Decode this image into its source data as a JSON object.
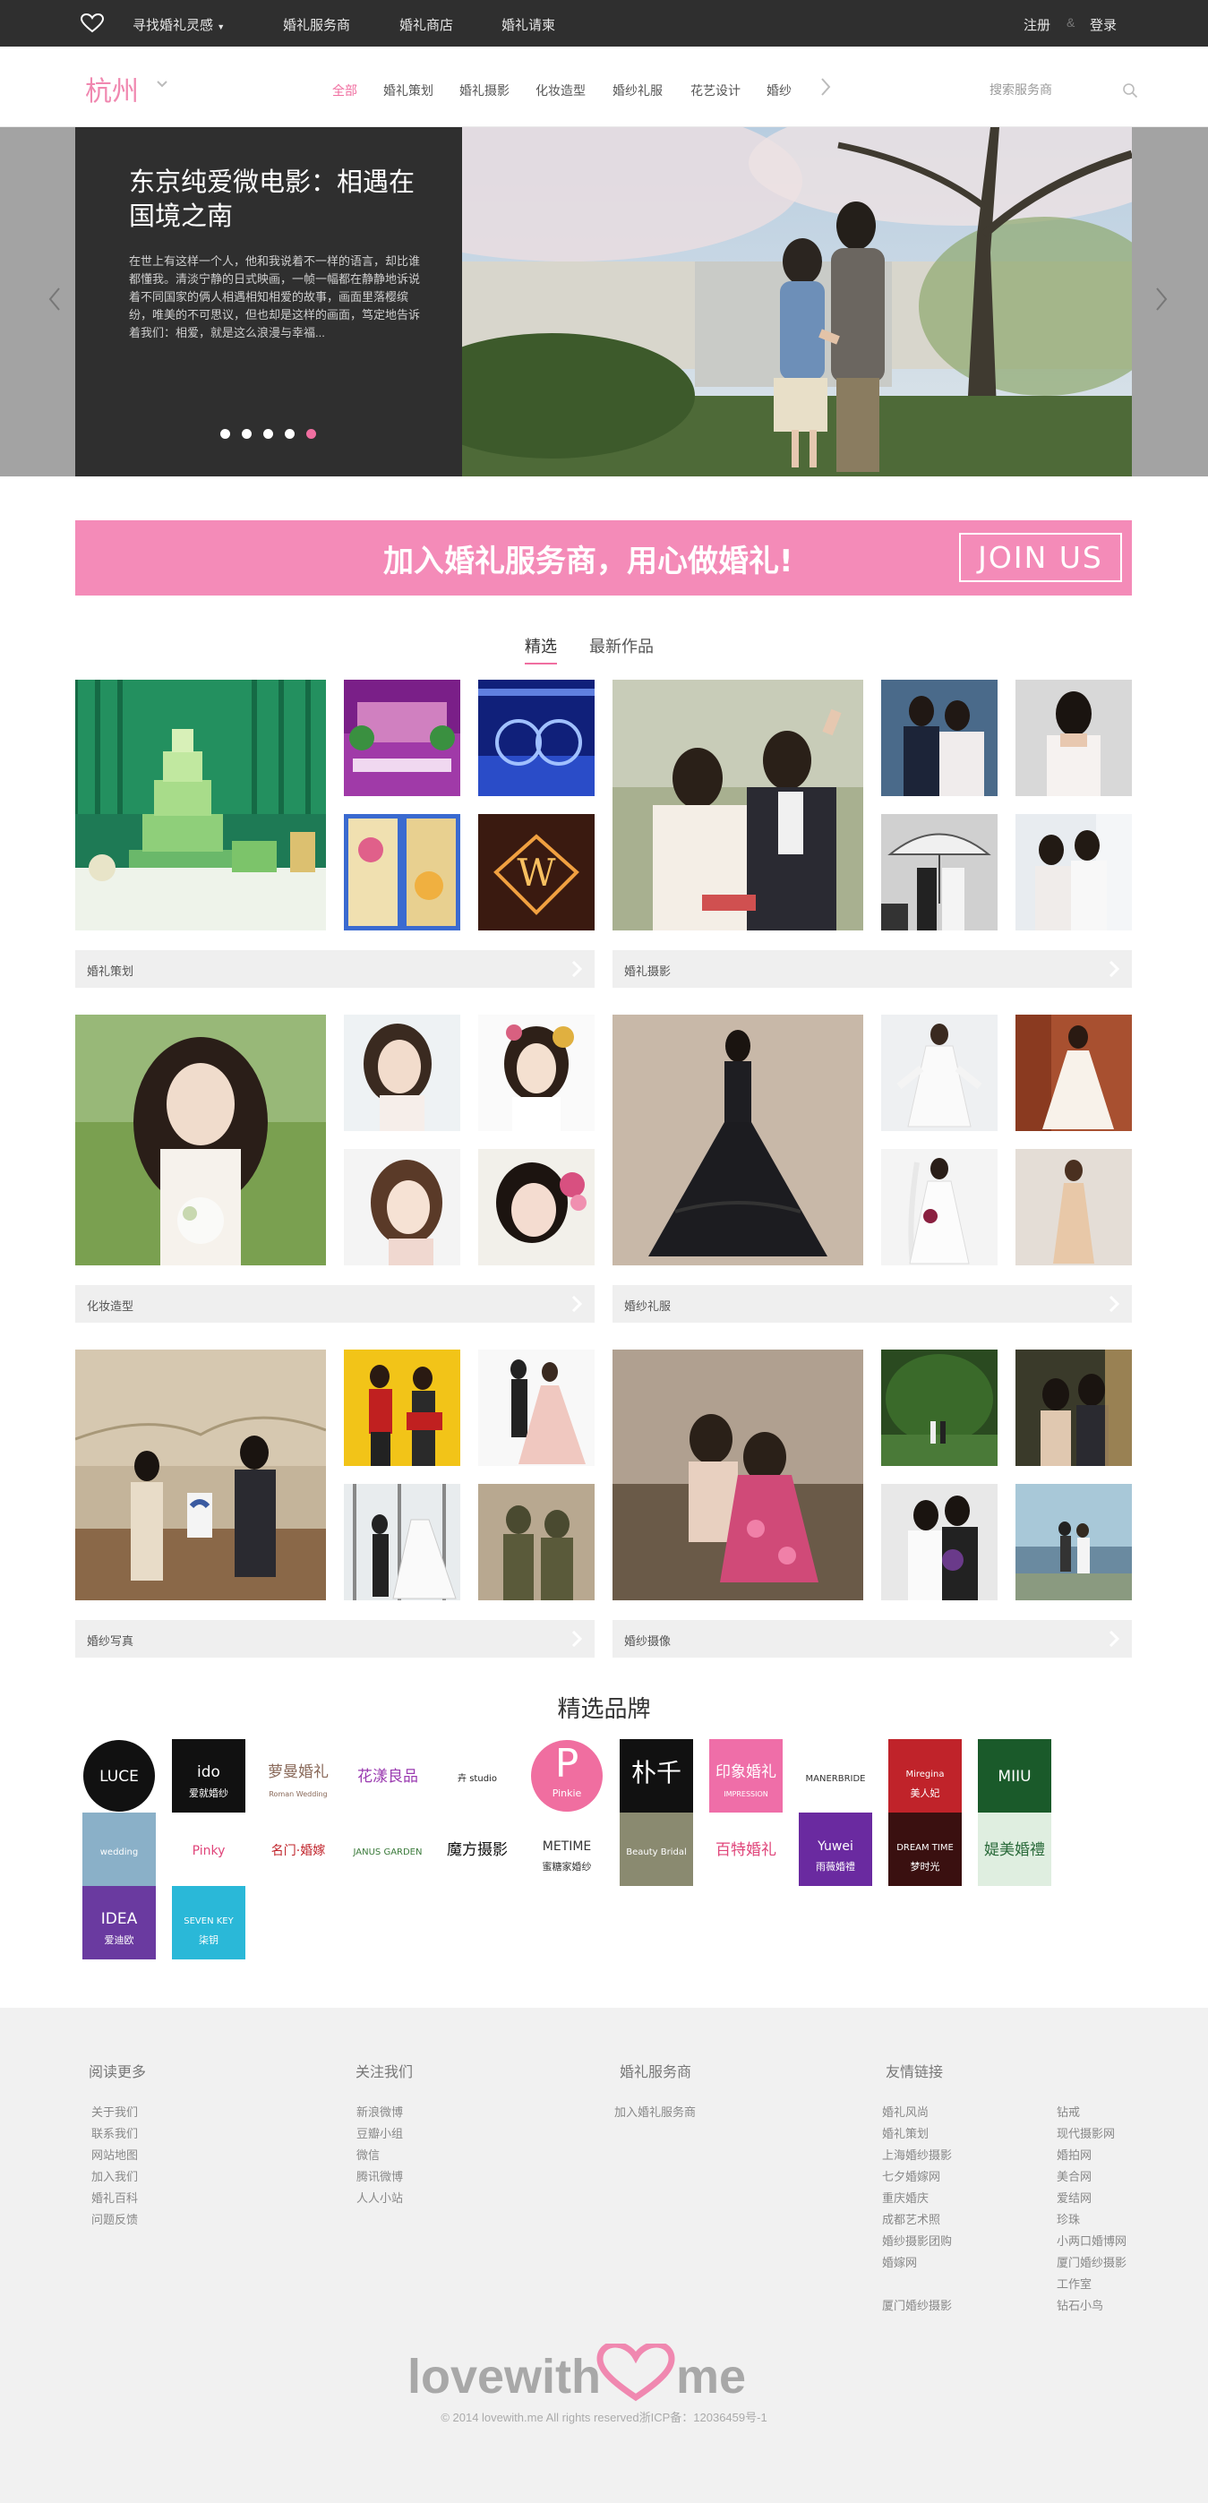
{
  "topbar": {
    "inspiration": "寻找婚礼灵感",
    "services": "婚礼服务商",
    "shop": "婚礼商店",
    "invite": "婚礼请柬",
    "register": "注册",
    "separator": "&",
    "login": "登录"
  },
  "header": {
    "city": "杭州",
    "categories": [
      "全部",
      "婚礼策划",
      "婚礼摄影",
      "化妆造型",
      "婚纱礼服",
      "花艺设计",
      "婚纱"
    ],
    "search_placeholder": "搜索服务商"
  },
  "hero": {
    "title": "东京纯爱微电影：相遇在国境之南",
    "description": "在世上有这样一个人，他和我说着不一样的语言，却比谁都懂我。清淡宁静的日式映画，一帧一幅都在静静地诉说着不同国家的俩人相遇相知相爱的故事，画面里落樱缤纷，唯美的不可思议，但也却是这样的画面，笃定地告诉着我们：相爱，就是这么浪漫与幸福...",
    "slide_count": 5,
    "active_slide": 5
  },
  "join": {
    "text": "加入婚礼服务商，用心做婚礼!",
    "button": "JOIN US"
  },
  "tabs": {
    "featured": "精选",
    "latest": "最新作品"
  },
  "cards": [
    {
      "label": "婚礼策划"
    },
    {
      "label": "婚礼摄影"
    },
    {
      "label": "化妆造型"
    },
    {
      "label": "婚纱礼服"
    },
    {
      "label": "婚纱写真"
    },
    {
      "label": "婚纱摄像"
    }
  ],
  "brands_title": "精选品牌",
  "brands": [
    {
      "name": "LUCE",
      "bg": "#111111",
      "fg": "#ffffff",
      "shape": "circle"
    },
    {
      "name": "ido",
      "sub": "爱就婚纱",
      "bg": "#111111",
      "fg": "#ffffff"
    },
    {
      "name": "萝曼婚礼",
      "sub": "Roman Wedding",
      "bg": "#ffffff",
      "fg": "#8a6a5a"
    },
    {
      "name": "花漾良品",
      "bg": "#ffffff",
      "fg": "#9a3ab0"
    },
    {
      "name": "卉 studio",
      "bg": "#ffffff",
      "fg": "#222222"
    },
    {
      "name": "P",
      "sub": "Pinkie",
      "bg": "#f06ea0",
      "fg": "#ffffff",
      "shape": "circle"
    },
    {
      "name": "朴千",
      "bg": "#111111",
      "fg": "#ffffff"
    },
    {
      "name": "印象婚礼",
      "sub": "IMPRESSION",
      "bg": "#ef6ea8",
      "fg": "#ffffff"
    },
    {
      "name": "MANERBRIDE",
      "bg": "#ffffff",
      "fg": "#333333"
    },
    {
      "name": "Miregina",
      "sub": "美人妃",
      "bg": "#c0232a",
      "fg": "#ffffff"
    },
    {
      "name": "MIIU",
      "bg": "#1a5a2a",
      "fg": "#ffffff"
    },
    {
      "name": "wedding",
      "bg": "#8ab0c8",
      "fg": "#ffffff"
    },
    {
      "name": "Pinky",
      "bg": "#ffffff",
      "fg": "#e0457a"
    },
    {
      "name": "名门·婚嫁",
      "bg": "#ffffff",
      "fg": "#c0232a"
    },
    {
      "name": "JANUS GARDEN",
      "bg": "#ffffff",
      "fg": "#3a7a3a"
    },
    {
      "name": "魔方摄影",
      "bg": "#ffffff",
      "fg": "#111111"
    },
    {
      "name": "METIME",
      "sub": "蜜糖家婚纱",
      "bg": "#ffffff",
      "fg": "#333333"
    },
    {
      "name": "Beauty Bridal",
      "bg": "#8a8a70",
      "fg": "#ffffff"
    },
    {
      "name": "百特婚礼",
      "bg": "#ffffff",
      "fg": "#e0457a"
    },
    {
      "name": "Yuwei",
      "sub": "雨薇婚禮",
      "bg": "#6a2aa0",
      "fg": "#ffffff"
    },
    {
      "name": "DREAM TIME",
      "sub": "梦时光",
      "bg": "#3a1010",
      "fg": "#ffffff"
    },
    {
      "name": "媞美婚禮",
      "bg": "#dfeee0",
      "fg": "#2a6a3a"
    },
    {
      "name": "IDEA",
      "sub": "爱迪欧",
      "bg": "#6a3aa0",
      "fg": "#ffffff"
    },
    {
      "name": "SEVEN KEY",
      "sub": "柒钥",
      "bg": "#2ab8d8",
      "fg": "#ffffff"
    }
  ],
  "footer": {
    "col1": {
      "title": "阅读更多",
      "items": [
        "关于我们",
        "联系我们",
        "网站地图",
        "加入我们",
        "婚礼百科",
        "问题反馈"
      ]
    },
    "col2": {
      "title": "关注我们",
      "items": [
        "新浪微博",
        "豆瓣小组",
        "微信",
        "腾讯微博",
        "人人小站"
      ]
    },
    "col3": {
      "title": "婚礼服务商",
      "items": [
        "加入婚礼服务商"
      ]
    },
    "col4": {
      "title": "友情链接",
      "items": [
        "婚礼风尚",
        "婚礼策划",
        "上海婚纱摄影",
        "七夕婚嫁网",
        "重庆婚庆",
        "成都艺术照",
        "婚纱摄影团购",
        "婚嫁网",
        "",
        "厦门婚纱摄影"
      ]
    },
    "col5": {
      "items": [
        "钻戒",
        "现代摄影网",
        "婚拍网",
        "美合网",
        "爱结网",
        "珍珠",
        "小两口婚博网",
        "厦门婚纱摄影",
        "工作室",
        "钻石小鸟"
      ]
    },
    "logo_left": "lovewith",
    "logo_right": "me",
    "copyright": "© 2014 lovewith.me All rights reserved浙ICP备：12036459号-1"
  },
  "colors": {
    "accent": "#f06ea0",
    "join_bg": "#f48bb8",
    "topbar": "#2f2f2f"
  }
}
